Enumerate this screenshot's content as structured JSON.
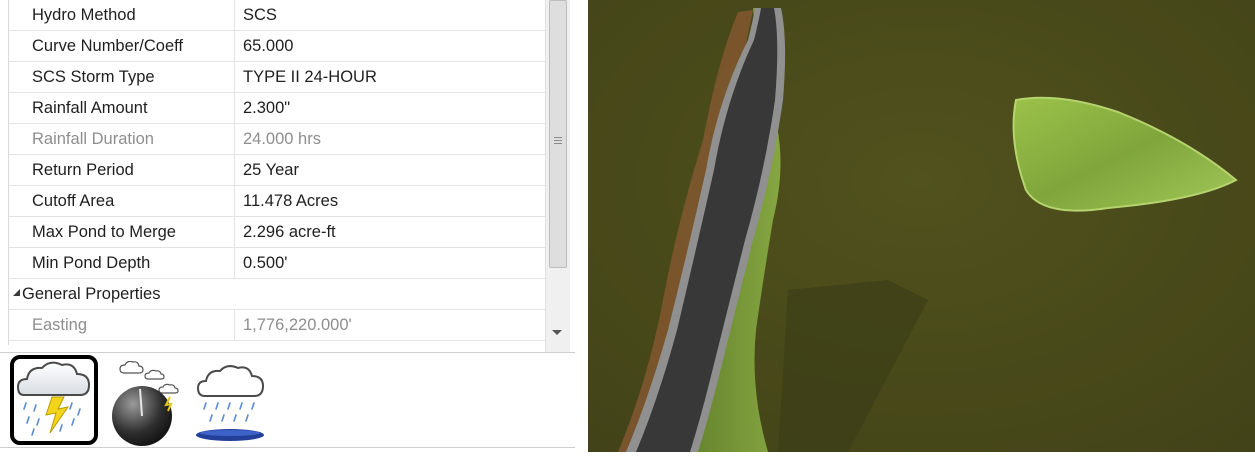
{
  "properties": {
    "rows": [
      {
        "name": "Hydro Method",
        "value": "SCS",
        "readonly": false
      },
      {
        "name": "Curve Number/Coeff",
        "value": "65.000",
        "readonly": false
      },
      {
        "name": "SCS Storm Type",
        "value": "TYPE II 24-HOUR",
        "readonly": false
      },
      {
        "name": "Rainfall Amount",
        "value": "2.300\"",
        "readonly": false
      },
      {
        "name": "Rainfall Duration",
        "value": "24.000 hrs",
        "readonly": true
      },
      {
        "name": "Return Period",
        "value": "25 Year",
        "readonly": false
      },
      {
        "name": "Cutoff Area",
        "value": "11.478 Acres",
        "readonly": false
      },
      {
        "name": "Max Pond to Merge",
        "value": "2.296 acre-ft",
        "readonly": false
      },
      {
        "name": "Min Pond Depth",
        "value": "0.500'",
        "readonly": false
      }
    ],
    "section": {
      "name": "General Properties",
      "expanded": true
    },
    "section_rows": [
      {
        "name": "Easting",
        "value": "1,776,220.000'",
        "readonly": true
      }
    ]
  },
  "toolbar": {
    "tools": [
      {
        "icon": "storm-cloud-lightning-icon",
        "selected": true
      },
      {
        "icon": "rain-gauge-icon",
        "selected": false
      },
      {
        "icon": "rain-pond-icon",
        "selected": false
      }
    ]
  },
  "colors": {
    "grass": "#4e4f1e",
    "hill": "#86ad3f",
    "road": "#3b3b3b",
    "road_edge": "#9a9a9a",
    "selection_border": "#000000"
  }
}
